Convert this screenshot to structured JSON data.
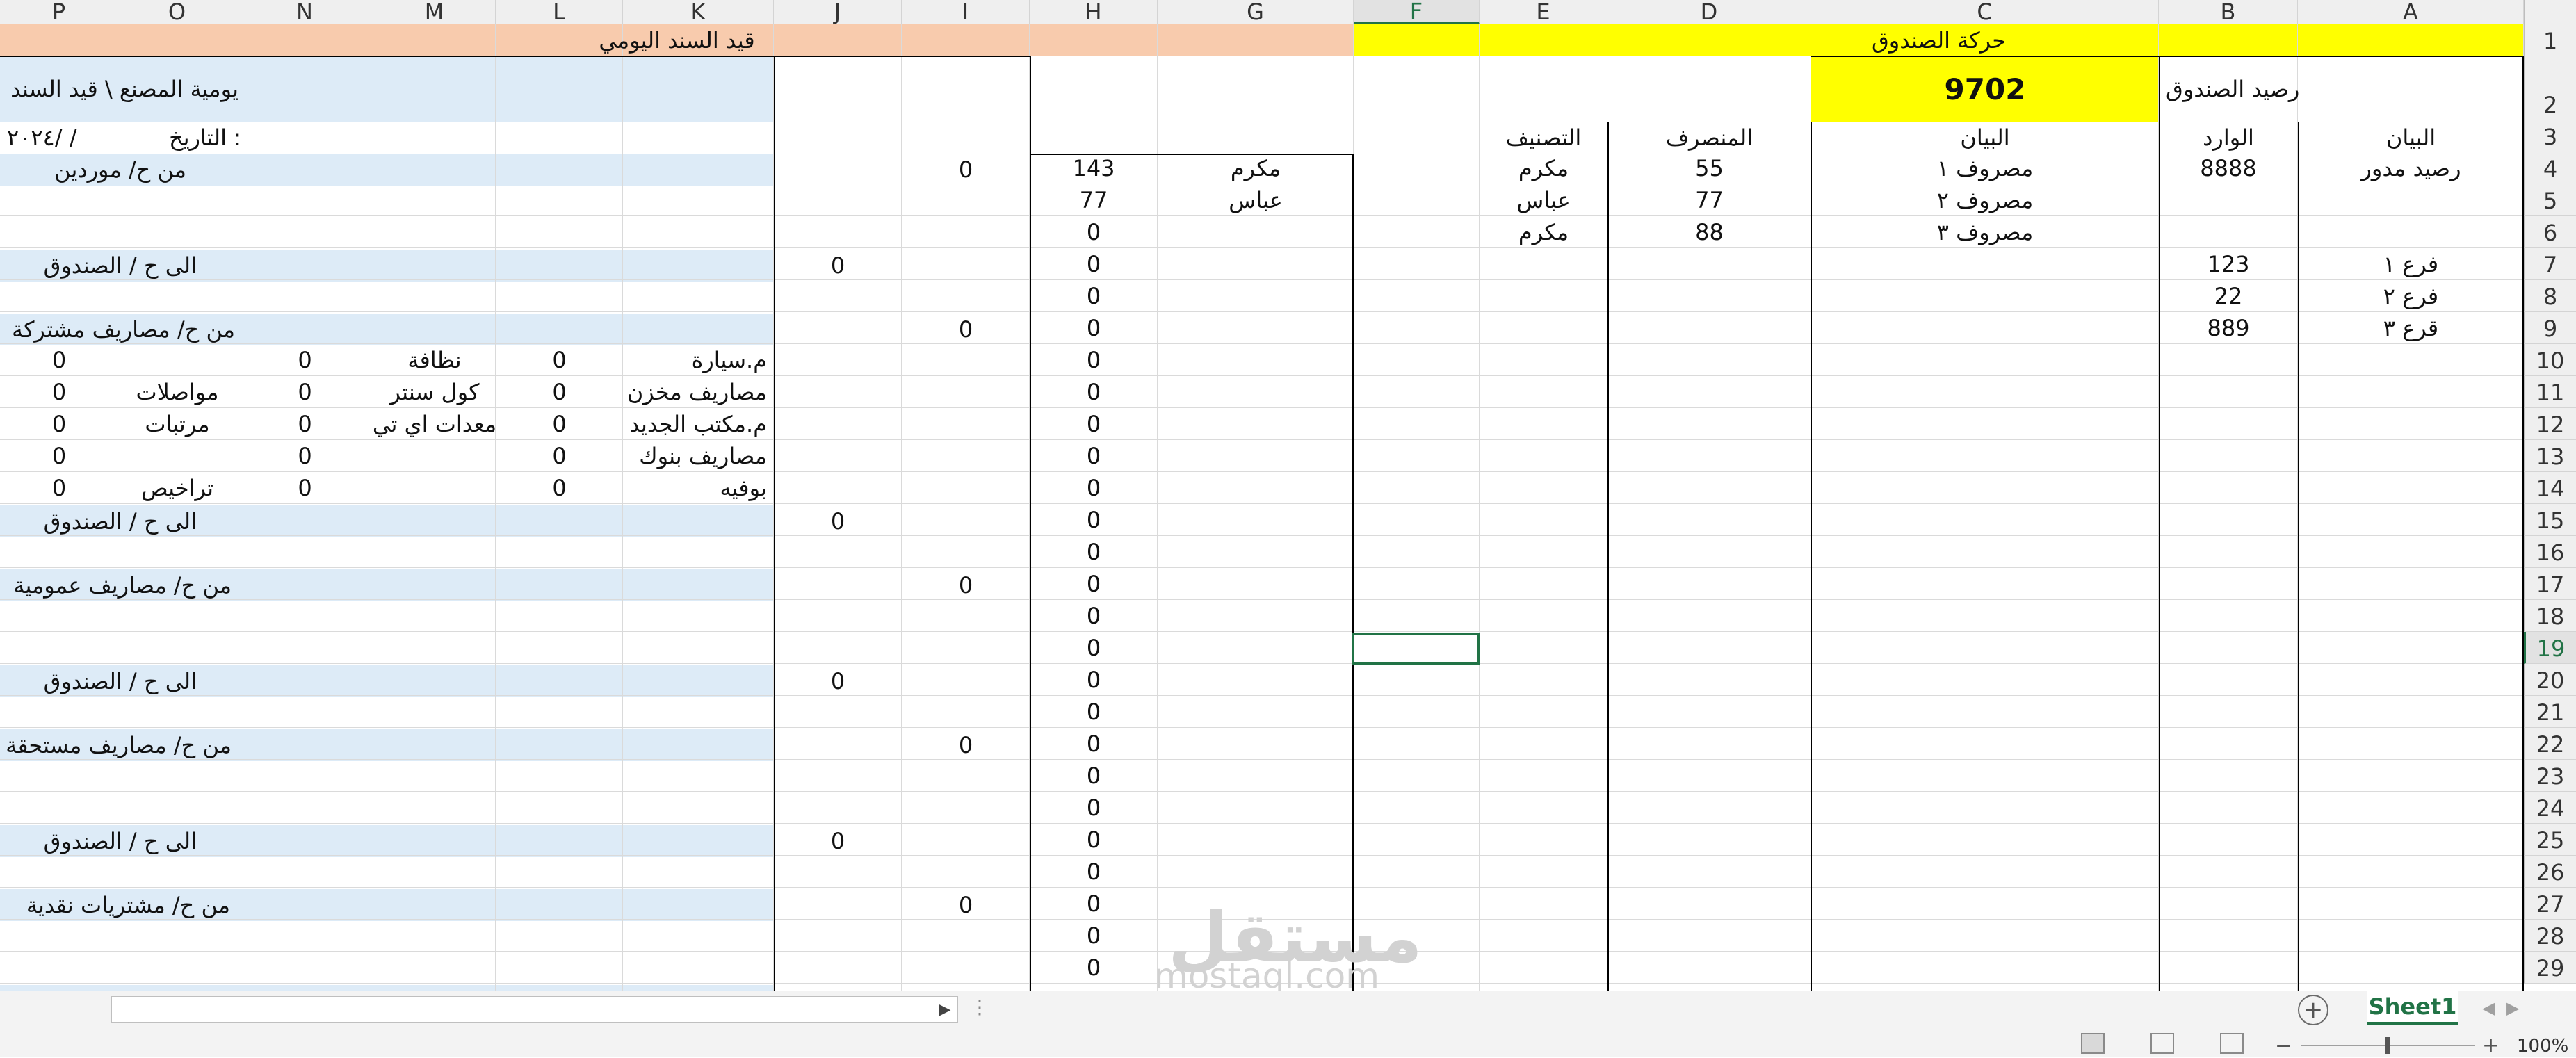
{
  "column_headers": [
    "P",
    "O",
    "N",
    "M",
    "L",
    "K",
    "J",
    "I",
    "H",
    "G",
    "F",
    "E",
    "D",
    "C",
    "B",
    "A"
  ],
  "row_headers": [
    "1",
    "2",
    "3",
    "4",
    "5",
    "6",
    "7",
    "8",
    "9",
    "10",
    "11",
    "12",
    "13",
    "14",
    "15",
    "16",
    "17",
    "18",
    "19",
    "20",
    "21",
    "22",
    "23",
    "24",
    "25",
    "26",
    "27",
    "28",
    "29"
  ],
  "selected_cell": "F19",
  "colors": {
    "yellow_header": "#ffff00",
    "peach_header": "#f8cbad",
    "light_blue": "#ddebf7",
    "excel_green": "#217346"
  },
  "cash_box": {
    "title": "حركة الصندوق",
    "balance_label": "رصيد الصندوق",
    "balance_value": "9702",
    "headers": {
      "a": "البيان",
      "b": "الوارد",
      "c": "البيان",
      "d": "المنصرف",
      "e": "التصنيف"
    },
    "incoming": [
      {
        "label": "رصيد مدور",
        "amount": "8888"
      },
      {
        "label": "",
        "amount": ""
      },
      {
        "label": "",
        "amount": ""
      },
      {
        "label": "فرع ١",
        "amount": "123"
      },
      {
        "label": "فرع ٢",
        "amount": "22"
      },
      {
        "label": "قرع ٣",
        "amount": "889"
      }
    ],
    "outgoing": [
      {
        "label": "مصروف ١",
        "amount": "55",
        "category": "مكرم"
      },
      {
        "label": "مصروف ٢",
        "amount": "77",
        "category": "عباس"
      },
      {
        "label": "مصروف ٣",
        "amount": "88",
        "category": "مكرم"
      }
    ]
  },
  "journal": {
    "title": "قيد السند اليومي",
    "subtitle": "يومية المصنع \\ قيد السند",
    "date_label": "التاريخ :",
    "date_value": "٢٠٢٤/     /",
    "h_values": [
      "143",
      "77",
      "0",
      "0",
      "0",
      "0",
      "0",
      "0",
      "0",
      "0",
      "0",
      "0",
      "0",
      "0",
      "0",
      "0",
      "0",
      "0",
      "0",
      "0",
      "0",
      "0",
      "0",
      "0",
      "0",
      "0"
    ],
    "g_values": [
      "مكرم",
      "عباس"
    ],
    "suppliers": {
      "label": "من ح/ موردين",
      "value": "0"
    },
    "cash_credit_label": "الى ح / الصندوق",
    "cash_credit_value": "0",
    "shared_expenses": {
      "label": "من ح/ مصاريف مشتركة",
      "value": "0"
    },
    "general_expenses": {
      "label": "من ح/ مصاريف عمومية",
      "value": "0"
    },
    "accrued_expenses": {
      "label": "من ح/ مصاريف مستحقة",
      "value": "0"
    },
    "cash_purchases": {
      "label": "من ح/ مشتريات نقدية",
      "value": "0"
    },
    "expense_items": [
      {
        "k": "م.سيارة",
        "l": "0",
        "m": "نظافة",
        "n": "0",
        "o": "",
        "p": "0"
      },
      {
        "k": "مصاريف مخزن",
        "l": "0",
        "m": "كول سنتر",
        "n": "0",
        "o": "مواصلات",
        "p": "0"
      },
      {
        "k": "م.مكتب الجديد",
        "l": "0",
        "m": "معدات اي تي",
        "n": "0",
        "o": "مرتبات",
        "p": "0"
      },
      {
        "k": "مصاريف بنوك",
        "l": "0",
        "m": "",
        "n": "0",
        "o": "",
        "p": "0"
      },
      {
        "k": "بوفيه",
        "l": "0",
        "m": "",
        "n": "0",
        "o": "تراخيص",
        "p": "0"
      }
    ]
  },
  "bottom_bar": {
    "sheet_tab": "Sheet1",
    "zoom": "100%"
  },
  "watermark": {
    "arabic": "مستقل",
    "latin": "mostaql.com"
  }
}
